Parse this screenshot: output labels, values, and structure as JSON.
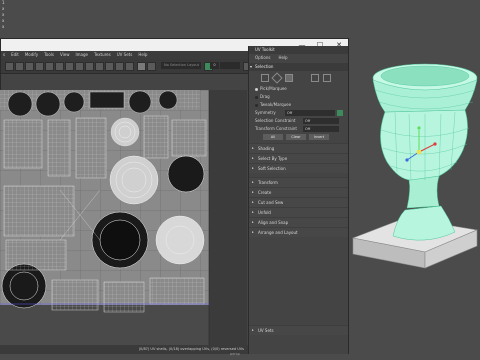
{
  "background": {
    "left_items": [
      "1",
      "x",
      "x",
      "x",
      "x"
    ],
    "bottom_text": "persp"
  },
  "window": {
    "controls": {
      "minimize": "—",
      "maximize": "☐",
      "close": "✕"
    },
    "menu": [
      "s",
      "Edit",
      "Modify",
      "Tools",
      "View",
      "Image",
      "Textures",
      "UV Sets",
      "Help"
    ],
    "toolbar": {
      "search_placeholder": "No Selection Layout",
      "num_value": "0"
    },
    "status_text": "(0/87) UV shells, (0/18) overlapping UVs, (0/0) reversed UVs"
  },
  "uv_toolkit": {
    "title": "UV Toolkit",
    "menu": [
      "Options",
      "Help"
    ],
    "sections": {
      "selection": "Selection",
      "pick_marquee": "Pick/Marquee",
      "drag": "Drag",
      "tweak_marquee": "Tweak/Marquee",
      "symmetry": "Symmetry",
      "symmetry_value": "Off",
      "selection_constraint": "Selection Constraint",
      "selection_constraint_value": "Off",
      "transform_constraint": "Transform Constraint",
      "transform_constraint_value": "Off",
      "buttons": [
        "All",
        "Clear",
        "Invert"
      ],
      "shading": "Shading",
      "select_by_type": "Select By Type",
      "soft_selection": "Soft Selection",
      "collapsed": [
        "Transform",
        "Create",
        "Cut and Sew",
        "Unfold",
        "Align and Snap",
        "Arrange and Layout"
      ],
      "uv_sets": "UV Sets"
    }
  },
  "colors": {
    "vase_wire": "#7de8c0",
    "vase_fill": "#b7f5de",
    "base_fill": "#d9d9d9"
  }
}
